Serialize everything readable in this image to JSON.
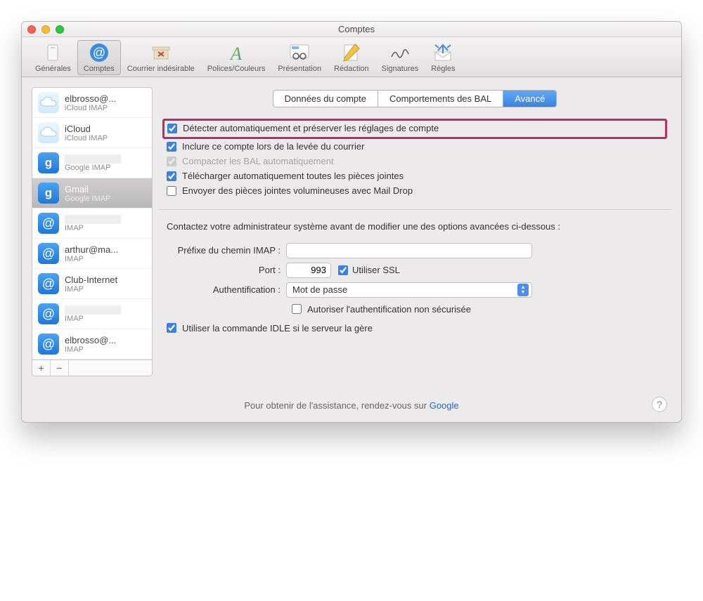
{
  "window": {
    "title": "Comptes"
  },
  "toolbar": {
    "items": [
      {
        "label": "Générales"
      },
      {
        "label": "Comptes"
      },
      {
        "label": "Courrier indésirable"
      },
      {
        "label": "Polices/Couleurs"
      },
      {
        "label": "Présentation"
      },
      {
        "label": "Rédaction"
      },
      {
        "label": "Signatures"
      },
      {
        "label": "Règles"
      }
    ]
  },
  "sidebar": {
    "accounts": [
      {
        "name": "elbrosso@...",
        "sub": "iCloud IMAP",
        "icon": "icloud"
      },
      {
        "name": "iCloud",
        "sub": "iCloud IMAP",
        "icon": "icloud"
      },
      {
        "name": "",
        "sub": "Google IMAP",
        "icon": "google",
        "redacted": true
      },
      {
        "name": "Gmail",
        "sub": "Google IMAP",
        "icon": "google",
        "selected": true
      },
      {
        "name": "",
        "sub": "IMAP",
        "icon": "at",
        "redacted": true
      },
      {
        "name": "arthur@ma...",
        "sub": "IMAP",
        "icon": "at"
      },
      {
        "name": "Club-Internet",
        "sub": "IMAP",
        "icon": "at"
      },
      {
        "name": "",
        "sub": "IMAP",
        "icon": "at",
        "redacted": true
      },
      {
        "name": "elbrosso@...",
        "sub": "IMAP",
        "icon": "at"
      }
    ]
  },
  "tabs": {
    "items": [
      {
        "label": "Données du compte"
      },
      {
        "label": "Comportements des BAL"
      },
      {
        "label": "Avancé",
        "active": true
      }
    ]
  },
  "options": {
    "detect": "Détecter automatiquement et préserver les réglages de compte",
    "include": "Inclure ce compte lors de la levée du courrier",
    "compact": "Compacter les BAL automatiquement",
    "download": "Télécharger automatiquement toutes les pièces jointes",
    "maildrop": "Envoyer des pièces jointes volumineuses avec Mail Drop"
  },
  "lower": {
    "note": "Contactez votre administrateur système avant de modifier une des options avancées ci-dessous :",
    "imap_prefix_label": "Préfixe du chemin IMAP :",
    "imap_prefix_value": "",
    "port_label": "Port :",
    "port_value": "993",
    "ssl_label": "Utiliser SSL",
    "auth_label": "Authentification :",
    "auth_value": "Mot de passe",
    "unsecure": "Autoriser l'authentification non sécurisée",
    "idle": "Utiliser la commande IDLE si le serveur la gère"
  },
  "footer": {
    "text": "Pour obtenir de l'assistance, rendez-vous sur ",
    "link": "Google"
  }
}
